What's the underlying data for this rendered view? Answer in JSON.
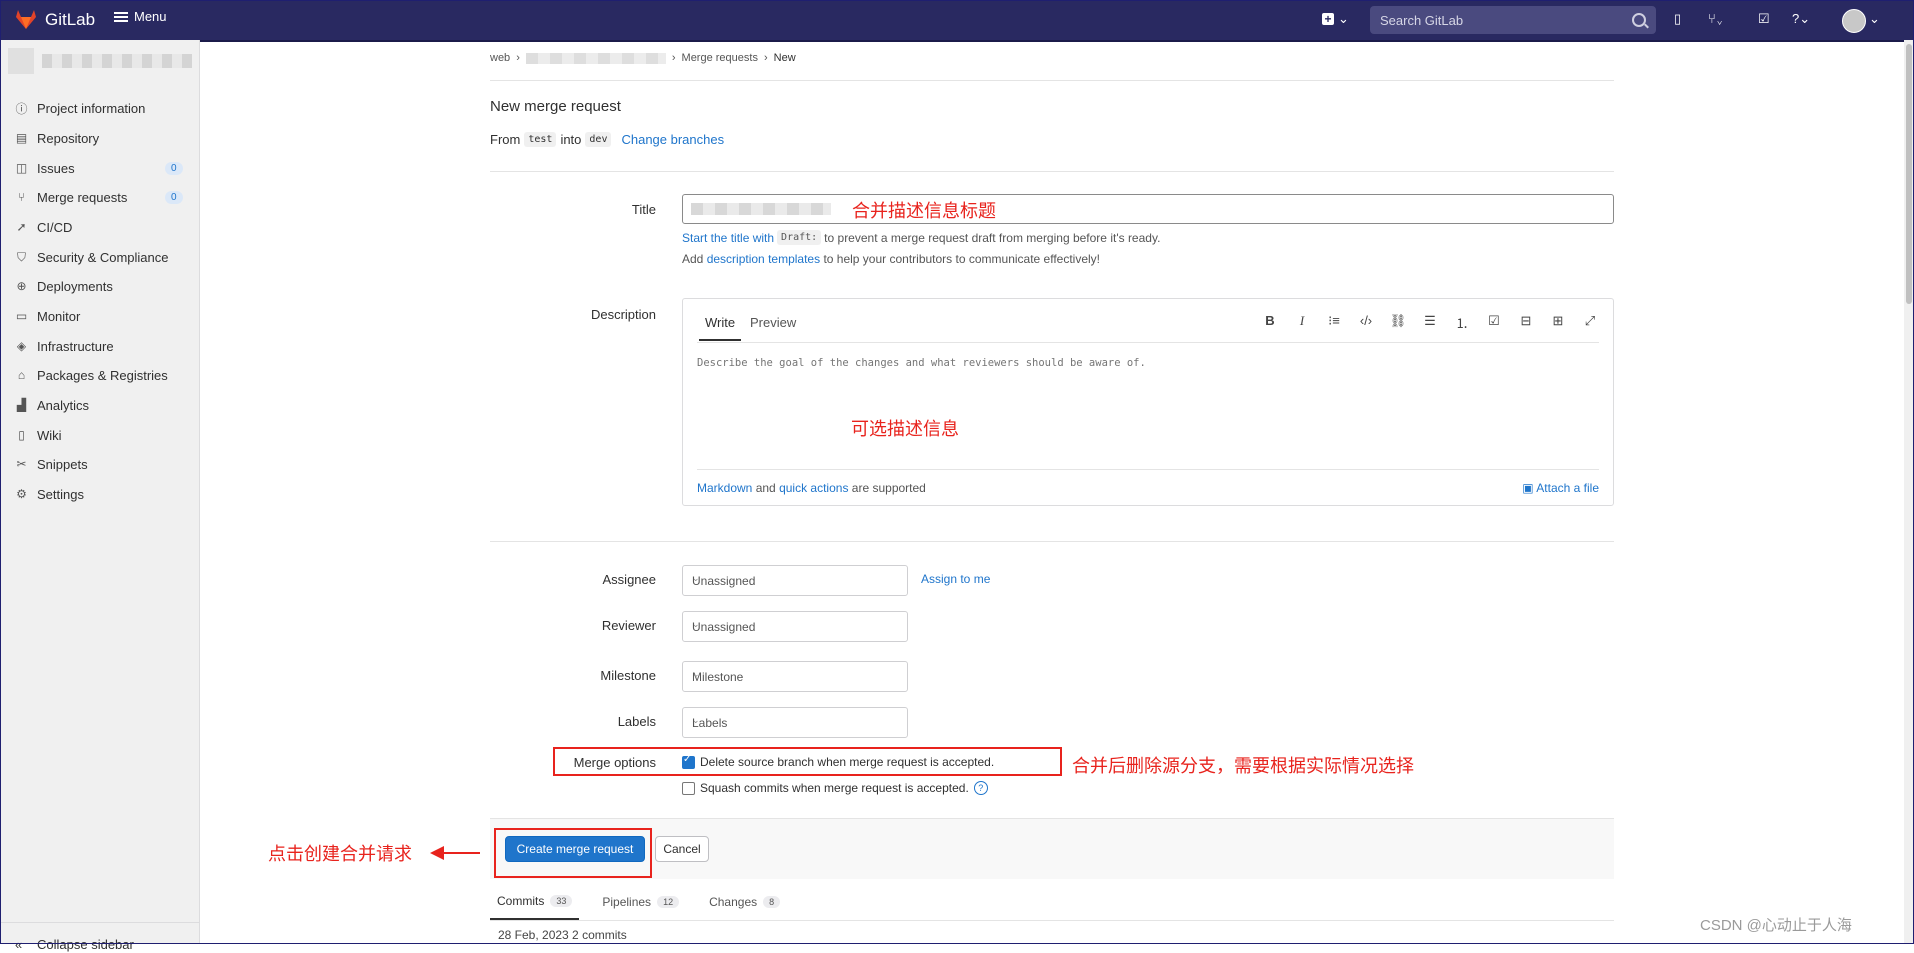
{
  "topbar": {
    "brand": "GitLab",
    "menu_label": "Menu",
    "search_placeholder": "Search GitLab"
  },
  "sidebar": {
    "items": [
      {
        "label": "Project information",
        "icon": "info-icon"
      },
      {
        "label": "Repository",
        "icon": "repository-icon"
      },
      {
        "label": "Issues",
        "icon": "issues-icon",
        "count": "0"
      },
      {
        "label": "Merge requests",
        "icon": "merge-request-icon",
        "count": "0"
      },
      {
        "label": "CI/CD",
        "icon": "rocket-icon"
      },
      {
        "label": "Security & Compliance",
        "icon": "shield-icon"
      },
      {
        "label": "Deployments",
        "icon": "deployments-icon"
      },
      {
        "label": "Monitor",
        "icon": "monitor-icon"
      },
      {
        "label": "Infrastructure",
        "icon": "infrastructure-icon"
      },
      {
        "label": "Packages & Registries",
        "icon": "package-icon"
      },
      {
        "label": "Analytics",
        "icon": "chart-icon"
      },
      {
        "label": "Wiki",
        "icon": "book-icon"
      },
      {
        "label": "Snippets",
        "icon": "snippet-icon"
      },
      {
        "label": "Settings",
        "icon": "gear-icon"
      }
    ],
    "collapse_label": "Collapse sidebar"
  },
  "breadcrumb": {
    "root": "web",
    "section": "Merge requests",
    "current": "New"
  },
  "page": {
    "title": "New merge request",
    "from_label": "From",
    "source_branch": "test",
    "into_label": "into",
    "target_branch": "dev",
    "change_branches": "Change branches"
  },
  "form": {
    "title_label": "Title",
    "draft_help_link": "Start the title with",
    "draft_code": "Draft:",
    "draft_help_rest": "to prevent a merge request draft from merging before it's ready.",
    "templates_add": "Add",
    "templates_link": "description templates",
    "templates_rest": "to help your contributors to communicate effectively!",
    "description_label": "Description",
    "tab_write": "Write",
    "tab_preview": "Preview",
    "description_placeholder": "Describe the goal of the changes and what reviewers should be aware of.",
    "markdown_link": "Markdown",
    "and": "and",
    "quick_actions_link": "quick actions",
    "supported": "are supported",
    "attach_file": "Attach a file",
    "assignee_label": "Assignee",
    "assignee_value": "Unassigned",
    "assign_to_me": "Assign to me",
    "reviewer_label": "Reviewer",
    "reviewer_value": "Unassigned",
    "milestone_label": "Milestone",
    "milestone_value": "Milestone",
    "labels_label": "Labels",
    "labels_value": "Labels",
    "merge_options_label": "Merge options",
    "delete_source_branch": "Delete source branch when merge request is accepted.",
    "delete_source_branch_checked": true,
    "squash_commits": "Squash commits when merge request is accepted.",
    "squash_commits_checked": false,
    "create_button": "Create merge request",
    "cancel_button": "Cancel"
  },
  "bottom_tabs": [
    {
      "label": "Commits",
      "count": "33"
    },
    {
      "label": "Pipelines",
      "count": "12"
    },
    {
      "label": "Changes",
      "count": "8"
    }
  ],
  "commits_line": "28 Feb, 2023 2 commits",
  "annotations": {
    "title_note": "合并描述信息标题",
    "desc_note": "可选描述信息",
    "merge_note": "合并后删除源分支，需要根据实际情况选择",
    "create_note": "点击创建合并请求"
  },
  "watermark": "CSDN @心动止于人海",
  "colors": {
    "nav": "#292961",
    "link": "#1f75cb",
    "annotation": "#e8231d"
  }
}
